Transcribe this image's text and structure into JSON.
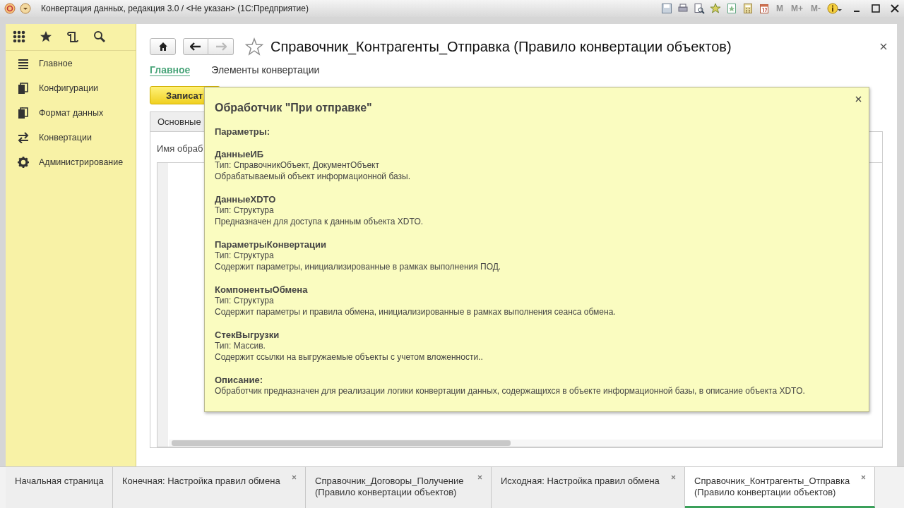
{
  "window": {
    "title": "Конвертация данных, редакция 3.0 / <Не указан>  (1С:Предприятие)",
    "memory_buttons": [
      {
        "label": "M",
        "disabled": true
      },
      {
        "label": "M+",
        "disabled": true
      },
      {
        "label": "M-",
        "disabled": true
      }
    ]
  },
  "sidebar": {
    "items": [
      {
        "label": "Главное",
        "kind": "list"
      },
      {
        "label": "Конфигурации",
        "kind": "docs"
      },
      {
        "label": "Формат данных",
        "kind": "docs"
      },
      {
        "label": "Конвертации",
        "kind": "arrows"
      },
      {
        "label": "Администрирование",
        "kind": "gear"
      }
    ]
  },
  "page": {
    "title": "Справочник_Контрагенты_Отправка (Правило конвертации объектов)",
    "favorite": false,
    "nav": {
      "back_disabled": false,
      "forward_disabled": true
    },
    "tabs": [
      {
        "label": "Главное",
        "selected": true
      },
      {
        "label": "Элементы конвертации",
        "selected": false
      }
    ],
    "save_button": "Записат",
    "form_tab": "Основные",
    "field_label": "Имя обраб"
  },
  "popup": {
    "title": "Обработчик \"При отправке\"",
    "params_heading": "Параметры:",
    "params": [
      {
        "name": "ДанныеИБ",
        "type": "Тип: СправочникОбъект, ДокументОбъект",
        "description": "Обрабатываемый объект информационной базы."
      },
      {
        "name": "ДанныеXDTO",
        "type": "Тип: Структура",
        "description": "Предназначен для доступа к данным объекта XDTO."
      },
      {
        "name": "ПараметрыКонвертации",
        "type": "Тип: Структура",
        "description": "Содержит параметры, инициализированные в рамках выполнения ПОД."
      },
      {
        "name": "КомпонентыОбмена",
        "type": "Тип: Структура",
        "description": "Содержит параметры и правила обмена,  инициализированные в рамках выполнения сеанса обмена."
      },
      {
        "name": "СтекВыгрузки",
        "type": "Тип: Массив.",
        "description": "Содержит ссылки на выгружаемые объекты с учетом вложенности.."
      }
    ],
    "description_heading": "Описание:",
    "description": "Обработчик предназначен для реализации логики конвертации данных, содержащихся в объекте информационной базы, в описание объекта XDTO."
  },
  "open_windows": [
    {
      "lines": [
        "Начальная страница"
      ],
      "closable": false,
      "selected": false
    },
    {
      "lines": [
        "Конечная: Настройка правил обмена"
      ],
      "closable": true,
      "selected": false
    },
    {
      "lines": [
        "Справочник_Договоры_Получение",
        "(Правило конвертации объектов)"
      ],
      "closable": true,
      "selected": false
    },
    {
      "lines": [
        "Исходная: Настройка правил обмена"
      ],
      "closable": true,
      "selected": false
    },
    {
      "lines": [
        "Справочник_Контрагенты_Отправка",
        "(Правило конвертации объектов)"
      ],
      "closable": true,
      "selected": true
    }
  ]
}
